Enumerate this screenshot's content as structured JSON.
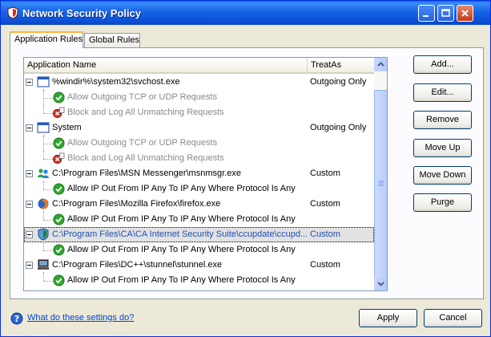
{
  "window": {
    "title": "Network Security Policy",
    "colors": {
      "titlebar": "#0c52d8",
      "selection_text": "#1f4fb4"
    }
  },
  "tabs": [
    {
      "label": "Application Rules",
      "active": true
    },
    {
      "label": "Global Rules",
      "active": false
    }
  ],
  "list": {
    "columns": {
      "name": "Application Name",
      "treat_as": "TreatAs"
    },
    "rows": [
      {
        "kind": "app",
        "icon": "window-app-icon",
        "name": "%windir%\\system32\\svchost.exe",
        "treat_as": "Outgoing Only"
      },
      {
        "kind": "rule",
        "icon": "check-icon",
        "name": "Allow Outgoing TCP or UDP Requests",
        "disabled": true
      },
      {
        "kind": "rule",
        "icon": "block-icon",
        "name": "Block and Log All Unmatching Requests",
        "disabled": true
      },
      {
        "kind": "app",
        "icon": "window-app-icon",
        "name": "System",
        "treat_as": "Outgoing Only"
      },
      {
        "kind": "rule",
        "icon": "check-icon",
        "name": "Allow Outgoing TCP or UDP Requests",
        "disabled": true
      },
      {
        "kind": "rule",
        "icon": "block-icon",
        "name": "Block and Log All Unmatching Requests",
        "disabled": true
      },
      {
        "kind": "app",
        "icon": "msn-messenger-icon",
        "name": "C:\\Program Files\\MSN Messenger\\msnmsgr.exe",
        "treat_as": "Custom"
      },
      {
        "kind": "rule",
        "icon": "check-icon",
        "name": "Allow IP Out From IP Any To IP Any Where Protocol Is Any"
      },
      {
        "kind": "app",
        "icon": "firefox-icon",
        "name": "C:\\Program Files\\Mozilla Firefox\\firefox.exe",
        "treat_as": "Custom"
      },
      {
        "kind": "rule",
        "icon": "check-icon",
        "name": "Allow IP Out From IP Any To IP Any Where Protocol Is Any"
      },
      {
        "kind": "app",
        "icon": "shield-app-icon",
        "name": "C:\\Program Files\\CA\\CA Internet Security Suite\\ccupdate\\ccupd...",
        "treat_as": "Custom",
        "selected": true
      },
      {
        "kind": "rule",
        "icon": "check-icon",
        "name": "Allow IP Out From IP Any To IP Any Where Protocol Is Any"
      },
      {
        "kind": "app",
        "icon": "computer-app-icon",
        "name": "C:\\Program Files\\DC++\\stunnel\\stunnel.exe",
        "treat_as": "Custom"
      },
      {
        "kind": "rule",
        "icon": "check-icon",
        "name": "Allow IP Out From IP Any To IP Any Where Protocol Is Any"
      }
    ]
  },
  "actions": {
    "add": "Add...",
    "edit": "Edit...",
    "remove": "Remove",
    "move_up": "Move Up",
    "move_down": "Move Down",
    "purge": "Purge"
  },
  "footer": {
    "help_link": "What do these settings do?",
    "apply": "Apply",
    "cancel": "Cancel"
  }
}
